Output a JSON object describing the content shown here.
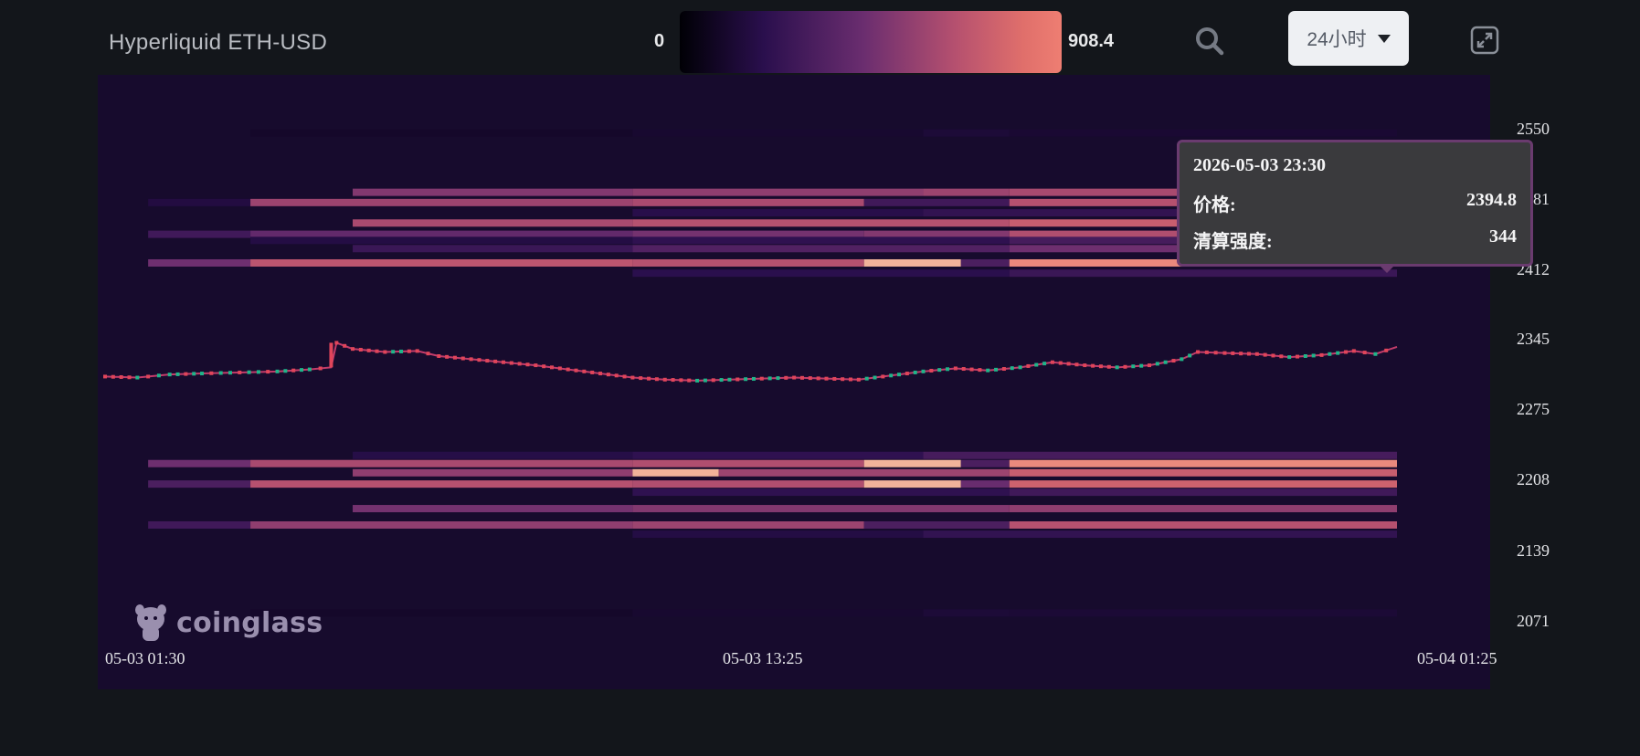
{
  "header": {
    "title": "Hyperliquid ETH-USD",
    "legend_min": "0",
    "legend_max": "908.4",
    "legend_colors": [
      "#000005",
      "#2a0f4d",
      "#6a2d6f",
      "#b5506f",
      "#ee7e72"
    ],
    "time_range": "24小时",
    "search_icon": "search-icon",
    "expand_icon": "expand-icon"
  },
  "watermark": "coinglass",
  "tooltip": {
    "time": "2026-05-03 23:30",
    "price_label": "价格:",
    "price_value": "2394.8",
    "intensity_label": "清算强度:",
    "intensity_value": "344"
  },
  "chart_data": {
    "type": "heatmap",
    "title": "Hyperliquid ETH-USD",
    "x_tick_labels": [
      "05-03 01:30",
      "05-03 13:25",
      "05-04 01:25"
    ],
    "y_tick_labels": [
      "2550",
      "2481",
      "2412",
      "2345",
      "2275",
      "2208",
      "2139",
      "2071"
    ],
    "ylim": [
      2040,
      2590
    ],
    "time_range_hours": [
      0,
      24
    ],
    "colorscale": {
      "min": 0,
      "max": 908.4
    },
    "colors": {
      "background": "#170b2d",
      "candle_up": "#1fb58a",
      "candle_down": "#e0455a",
      "price_line": "#c23c6a"
    },
    "liquidation_levels": [
      {
        "price": 2545,
        "segments": [
          [
            2.7,
            9.8,
            60
          ],
          [
            9.8,
            15.2,
            80
          ],
          [
            15.2,
            16.8,
            110
          ],
          [
            16.8,
            24,
            90
          ]
        ]
      },
      {
        "price": 2487,
        "segments": [
          [
            4.6,
            9.8,
            480
          ],
          [
            9.8,
            15.2,
            520
          ],
          [
            15.2,
            16.8,
            560
          ],
          [
            16.8,
            24,
            600
          ]
        ]
      },
      {
        "price": 2477,
        "segments": [
          [
            0.8,
            2.7,
            140
          ],
          [
            2.7,
            9.8,
            560
          ],
          [
            9.8,
            14.1,
            600
          ],
          [
            14.1,
            16.8,
            260
          ],
          [
            16.8,
            24,
            640
          ]
        ]
      },
      {
        "price": 2467,
        "segments": [
          [
            9.8,
            15.2,
            170
          ],
          [
            15.2,
            24,
            210
          ]
        ]
      },
      {
        "price": 2457,
        "segments": [
          [
            4.6,
            9.8,
            600
          ],
          [
            9.8,
            16.8,
            640
          ],
          [
            16.8,
            24,
            700
          ]
        ]
      },
      {
        "price": 2446,
        "segments": [
          [
            0.8,
            2.7,
            260
          ],
          [
            2.7,
            9.8,
            380
          ],
          [
            9.8,
            14.1,
            440
          ],
          [
            14.1,
            16.8,
            480
          ],
          [
            16.8,
            24,
            620
          ]
        ]
      },
      {
        "price": 2440,
        "segments": [
          [
            2.7,
            9.8,
            150
          ],
          [
            9.8,
            16.8,
            200
          ],
          [
            16.8,
            24,
            280
          ]
        ]
      },
      {
        "price": 2432,
        "segments": [
          [
            4.6,
            9.8,
            240
          ],
          [
            9.8,
            16.8,
            320
          ],
          [
            16.8,
            24,
            420
          ]
        ]
      },
      {
        "price": 2418,
        "segments": [
          [
            0.8,
            2.7,
            420
          ],
          [
            2.7,
            9.8,
            660
          ],
          [
            9.8,
            14.1,
            640
          ],
          [
            14.1,
            15.9,
            860
          ],
          [
            15.9,
            16.8,
            300
          ],
          [
            16.8,
            24,
            820
          ]
        ]
      },
      {
        "price": 2408,
        "segments": [
          [
            9.8,
            16.8,
            180
          ],
          [
            16.8,
            24,
            240
          ]
        ]
      },
      {
        "price": 2230,
        "segments": [
          [
            4.6,
            9.8,
            160
          ],
          [
            9.8,
            15.2,
            200
          ],
          [
            15.2,
            24,
            280
          ]
        ]
      },
      {
        "price": 2222,
        "segments": [
          [
            0.8,
            2.7,
            420
          ],
          [
            2.7,
            9.8,
            600
          ],
          [
            9.8,
            14.1,
            620
          ],
          [
            14.1,
            15.9,
            860
          ],
          [
            15.9,
            16.8,
            300
          ],
          [
            16.8,
            24,
            820
          ]
        ]
      },
      {
        "price": 2213,
        "segments": [
          [
            4.6,
            9.8,
            520
          ],
          [
            9.8,
            11.4,
            860
          ],
          [
            11.4,
            16.8,
            560
          ],
          [
            16.8,
            24,
            700
          ]
        ]
      },
      {
        "price": 2202,
        "segments": [
          [
            0.8,
            2.7,
            300
          ],
          [
            2.7,
            9.8,
            640
          ],
          [
            9.8,
            14.1,
            620
          ],
          [
            14.1,
            15.9,
            860
          ],
          [
            15.9,
            16.8,
            400
          ],
          [
            16.8,
            24,
            720
          ]
        ]
      },
      {
        "price": 2194,
        "segments": [
          [
            9.8,
            16.8,
            200
          ],
          [
            16.8,
            24,
            260
          ]
        ]
      },
      {
        "price": 2178,
        "segments": [
          [
            4.6,
            9.8,
            440
          ],
          [
            9.8,
            16.8,
            480
          ],
          [
            16.8,
            24,
            520
          ]
        ]
      },
      {
        "price": 2162,
        "segments": [
          [
            0.8,
            2.7,
            260
          ],
          [
            2.7,
            9.8,
            520
          ],
          [
            9.8,
            14.1,
            560
          ],
          [
            14.1,
            16.8,
            300
          ],
          [
            16.8,
            24,
            640
          ]
        ]
      },
      {
        "price": 2153,
        "segments": [
          [
            9.8,
            15.2,
            150
          ],
          [
            15.2,
            24,
            210
          ]
        ]
      },
      {
        "price": 2076,
        "segments": [
          [
            2.7,
            9.8,
            60
          ],
          [
            9.8,
            15.2,
            80
          ],
          [
            15.2,
            16.8,
            110
          ],
          [
            16.8,
            24,
            100
          ]
        ]
      }
    ],
    "price_series": {
      "name": "ETH-USD",
      "points": [
        [
          0,
          2307
        ],
        [
          0.6,
          2306
        ],
        [
          0.8,
          2307
        ],
        [
          1.2,
          2309
        ],
        [
          1.8,
          2310
        ],
        [
          2.5,
          2311
        ],
        [
          3.2,
          2312
        ],
        [
          3.8,
          2314
        ],
        [
          4.2,
          2316
        ],
        [
          4.3,
          2340
        ],
        [
          4.6,
          2334
        ],
        [
          5.2,
          2331
        ],
        [
          5.8,
          2332
        ],
        [
          6.2,
          2327
        ],
        [
          6.8,
          2324
        ],
        [
          7.4,
          2321
        ],
        [
          8.0,
          2318
        ],
        [
          8.6,
          2314
        ],
        [
          9.2,
          2310
        ],
        [
          9.8,
          2306
        ],
        [
          10.4,
          2304
        ],
        [
          11.0,
          2303
        ],
        [
          11.6,
          2304
        ],
        [
          12.2,
          2305
        ],
        [
          12.8,
          2306
        ],
        [
          13.4,
          2305
        ],
        [
          14.0,
          2304
        ],
        [
          14.6,
          2308
        ],
        [
          15.2,
          2312
        ],
        [
          15.8,
          2315
        ],
        [
          16.4,
          2313
        ],
        [
          17.0,
          2316
        ],
        [
          17.6,
          2321
        ],
        [
          18.2,
          2318
        ],
        [
          18.8,
          2316
        ],
        [
          19.4,
          2318
        ],
        [
          20.0,
          2324
        ],
        [
          20.3,
          2331
        ],
        [
          20.8,
          2330
        ],
        [
          21.4,
          2329
        ],
        [
          22.0,
          2326
        ],
        [
          22.6,
          2328
        ],
        [
          23.2,
          2332
        ],
        [
          23.6,
          2329
        ],
        [
          24,
          2336
        ]
      ]
    }
  }
}
